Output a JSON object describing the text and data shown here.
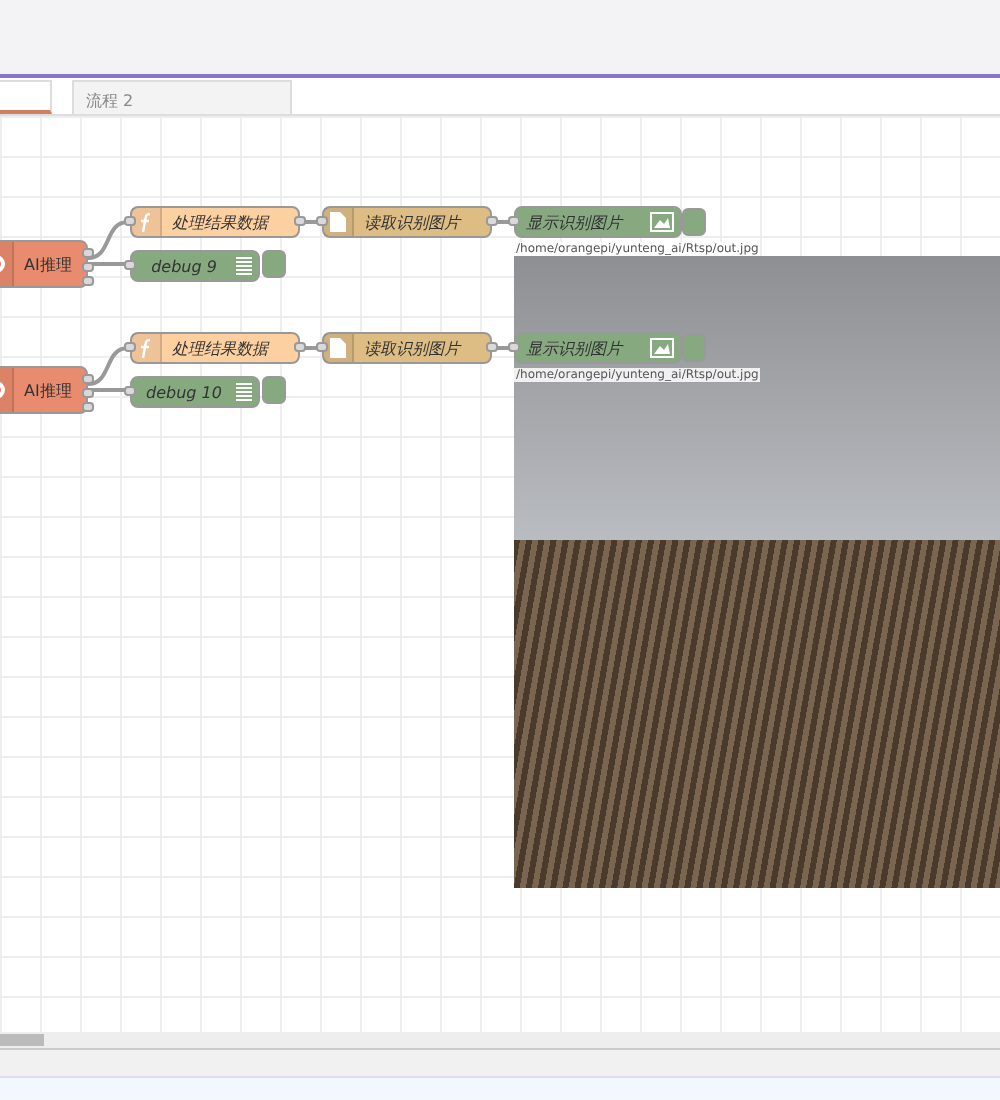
{
  "tabs": [
    {
      "selected": true
    },
    {
      "label": "流程 2",
      "selected": false
    }
  ],
  "flows": [
    {
      "ai_node": "AI推理",
      "function_node": "处理结果数据",
      "file_node": "读取识别图片",
      "image_node": "显示识别图片",
      "image_path": "/home/orangepi/yunteng_ai/Rtsp/out.jpg",
      "debug_node": "debug 9"
    },
    {
      "ai_node": "AI推理",
      "function_node": "处理结果数据",
      "file_node": "读取识别图片",
      "image_node": "显示识别图片",
      "image_path": "/home/orangepi/yunteng_ai/Rtsp/out.jpg",
      "debug_node": "debug 10"
    }
  ]
}
